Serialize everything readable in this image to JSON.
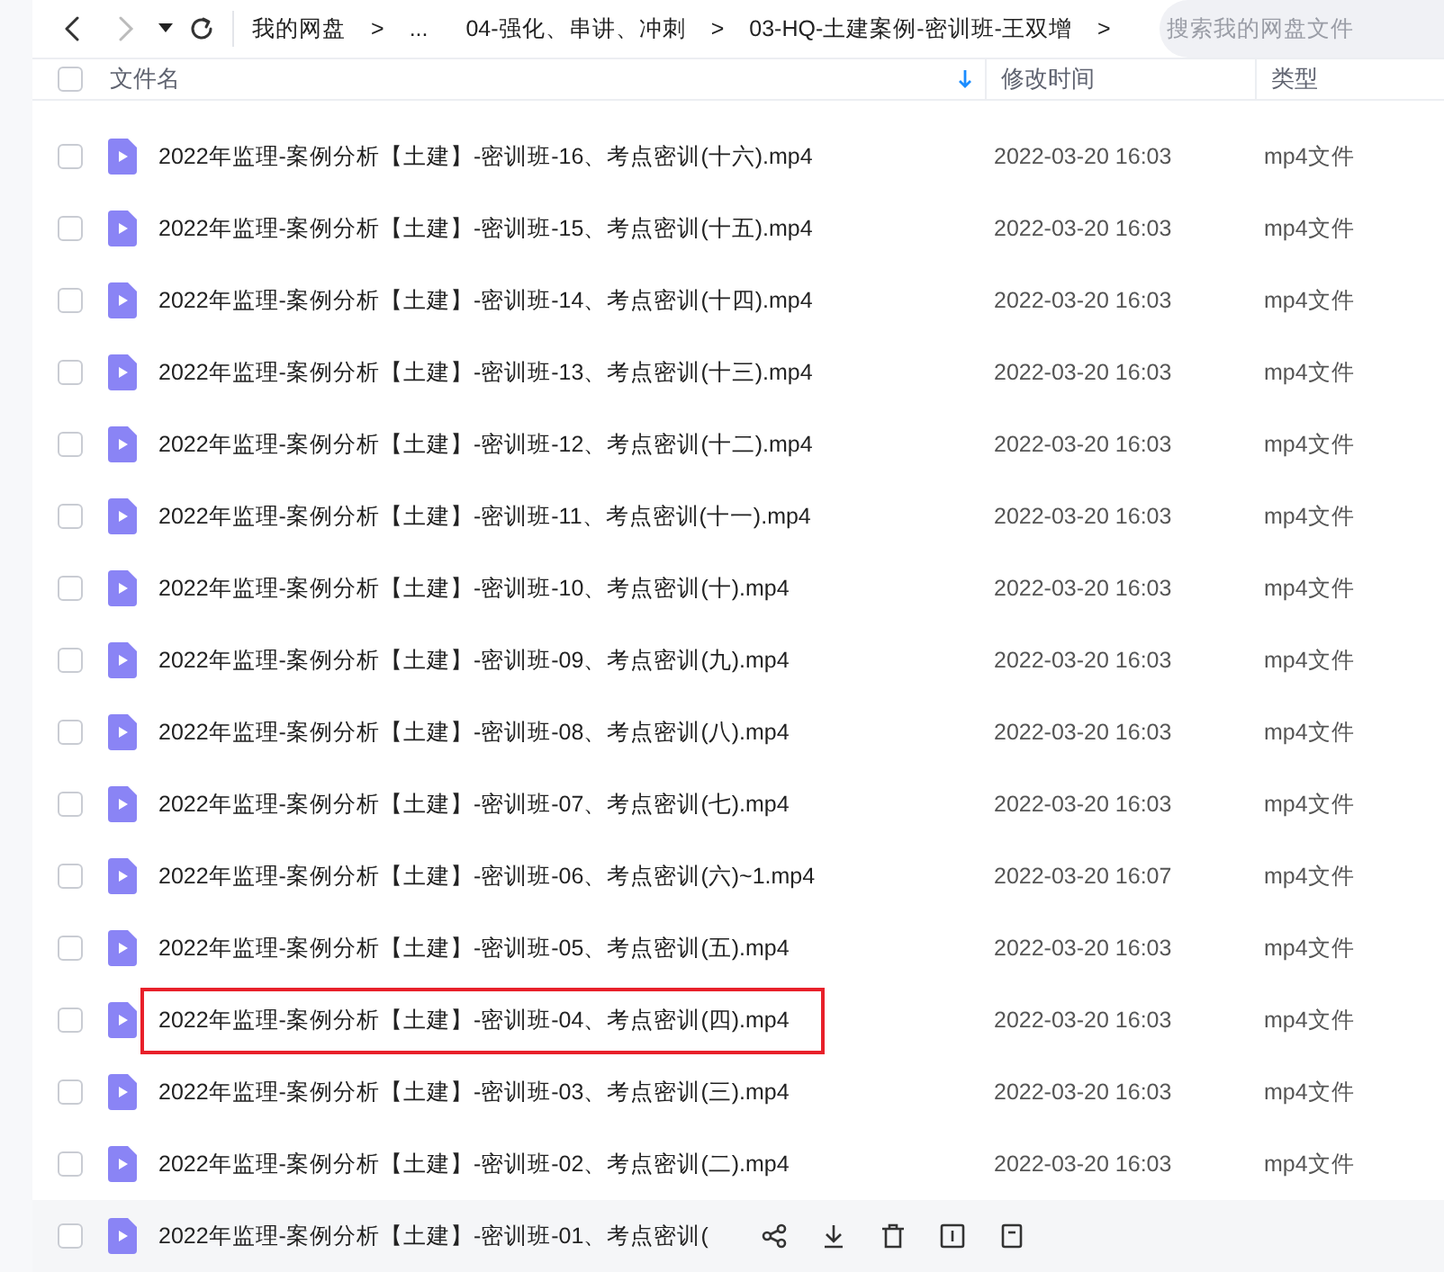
{
  "toolbar": {
    "breadcrumbs": [
      {
        "label": "我的网盘"
      },
      {
        "label": "..."
      },
      {
        "label": "04-强化、串讲、冲刺"
      },
      {
        "label": "03-HQ-土建案例-密训班-王双增"
      }
    ],
    "separator": ">",
    "search": {
      "placeholder": "搜索我的网盘文件"
    }
  },
  "table": {
    "select_all": {
      "checked": false
    },
    "columns": [
      {
        "label": "文件名",
        "sorted": true
      },
      {
        "label": "修改时间",
        "sorted": false
      },
      {
        "label": "类型",
        "sorted": false
      }
    ],
    "rows": [
      {
        "name": "2022年监理-案例分析【土建】-密训班-16、考点密训(十六).mp4",
        "time": "2022-03-20 16:03",
        "type": "mp4文件",
        "checked": false,
        "highlighted": false,
        "hovered": false
      },
      {
        "name": "2022年监理-案例分析【土建】-密训班-15、考点密训(十五).mp4",
        "time": "2022-03-20 16:03",
        "type": "mp4文件",
        "checked": false,
        "highlighted": false,
        "hovered": false
      },
      {
        "name": "2022年监理-案例分析【土建】-密训班-14、考点密训(十四).mp4",
        "time": "2022-03-20 16:03",
        "type": "mp4文件",
        "checked": false,
        "highlighted": false,
        "hovered": false
      },
      {
        "name": "2022年监理-案例分析【土建】-密训班-13、考点密训(十三).mp4",
        "time": "2022-03-20 16:03",
        "type": "mp4文件",
        "checked": false,
        "highlighted": false,
        "hovered": false
      },
      {
        "name": "2022年监理-案例分析【土建】-密训班-12、考点密训(十二).mp4",
        "time": "2022-03-20 16:03",
        "type": "mp4文件",
        "checked": false,
        "highlighted": false,
        "hovered": false
      },
      {
        "name": "2022年监理-案例分析【土建】-密训班-11、考点密训(十一).mp4",
        "time": "2022-03-20 16:03",
        "type": "mp4文件",
        "checked": false,
        "highlighted": false,
        "hovered": false
      },
      {
        "name": "2022年监理-案例分析【土建】-密训班-10、考点密训(十).mp4",
        "time": "2022-03-20 16:03",
        "type": "mp4文件",
        "checked": false,
        "highlighted": false,
        "hovered": false
      },
      {
        "name": "2022年监理-案例分析【土建】-密训班-09、考点密训(九).mp4",
        "time": "2022-03-20 16:03",
        "type": "mp4文件",
        "checked": false,
        "highlighted": false,
        "hovered": false
      },
      {
        "name": "2022年监理-案例分析【土建】-密训班-08、考点密训(八).mp4",
        "time": "2022-03-20 16:03",
        "type": "mp4文件",
        "checked": false,
        "highlighted": false,
        "hovered": false
      },
      {
        "name": "2022年监理-案例分析【土建】-密训班-07、考点密训(七).mp4",
        "time": "2022-03-20 16:03",
        "type": "mp4文件",
        "checked": false,
        "highlighted": false,
        "hovered": false
      },
      {
        "name": "2022年监理-案例分析【土建】-密训班-06、考点密训(六)~1.mp4",
        "time": "2022-03-20 16:07",
        "type": "mp4文件",
        "checked": false,
        "highlighted": false,
        "hovered": false
      },
      {
        "name": "2022年监理-案例分析【土建】-密训班-05、考点密训(五).mp4",
        "time": "2022-03-20 16:03",
        "type": "mp4文件",
        "checked": false,
        "highlighted": false,
        "hovered": false
      },
      {
        "name": "2022年监理-案例分析【土建】-密训班-04、考点密训(四).mp4",
        "time": "2022-03-20 16:03",
        "type": "mp4文件",
        "checked": false,
        "highlighted": true,
        "hovered": false
      },
      {
        "name": "2022年监理-案例分析【土建】-密训班-03、考点密训(三).mp4",
        "time": "2022-03-20 16:03",
        "type": "mp4文件",
        "checked": false,
        "highlighted": false,
        "hovered": false
      },
      {
        "name": "2022年监理-案例分析【土建】-密训班-02、考点密训(二).mp4",
        "time": "2022-03-20 16:03",
        "type": "mp4文件",
        "checked": false,
        "highlighted": false,
        "hovered": false
      },
      {
        "name": "2022年监理-案例分析【土建】-密训班-01、考点密训(",
        "checked": false,
        "highlighted": false,
        "hovered": true
      }
    ]
  }
}
